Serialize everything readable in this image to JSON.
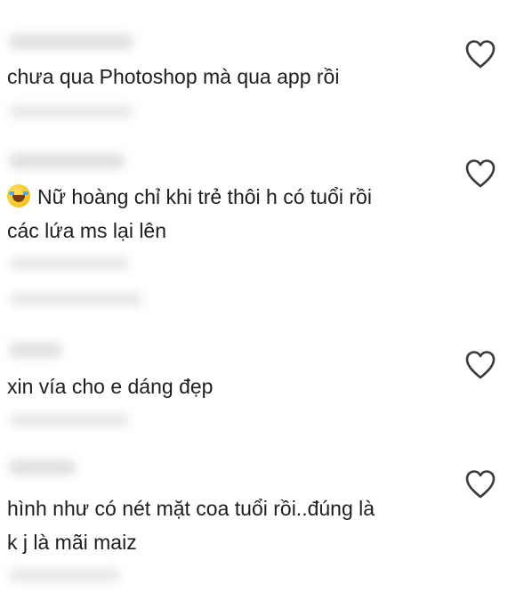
{
  "comments": [
    {
      "text_lines": [
        "chưa qua Photoshop mà qua app rồi"
      ],
      "has_emoji": false,
      "like_icon": "heart-outline-icon"
    },
    {
      "text_lines": [
        "Nữ hoàng chỉ khi trẻ thôi h có tuổi rồi",
        "các lứa ms lại lên"
      ],
      "has_emoji": true,
      "emoji": "laughing-with-tears-emoji",
      "like_icon": "heart-outline-icon"
    },
    {
      "text_lines": [
        "xin vía cho e dáng đẹp"
      ],
      "has_emoji": false,
      "like_icon": "heart-outline-icon"
    },
    {
      "text_lines": [
        "hình như có nét mặt coa tuổi rồi..đúng là",
        "k j là mãi maiz"
      ],
      "has_emoji": false,
      "like_icon": "heart-outline-icon"
    }
  ],
  "colors": {
    "background": "#ffffff",
    "text": "#1d1d1d",
    "icon": "#3a3a3a",
    "blurred_placeholder": "#d8d8d8"
  }
}
